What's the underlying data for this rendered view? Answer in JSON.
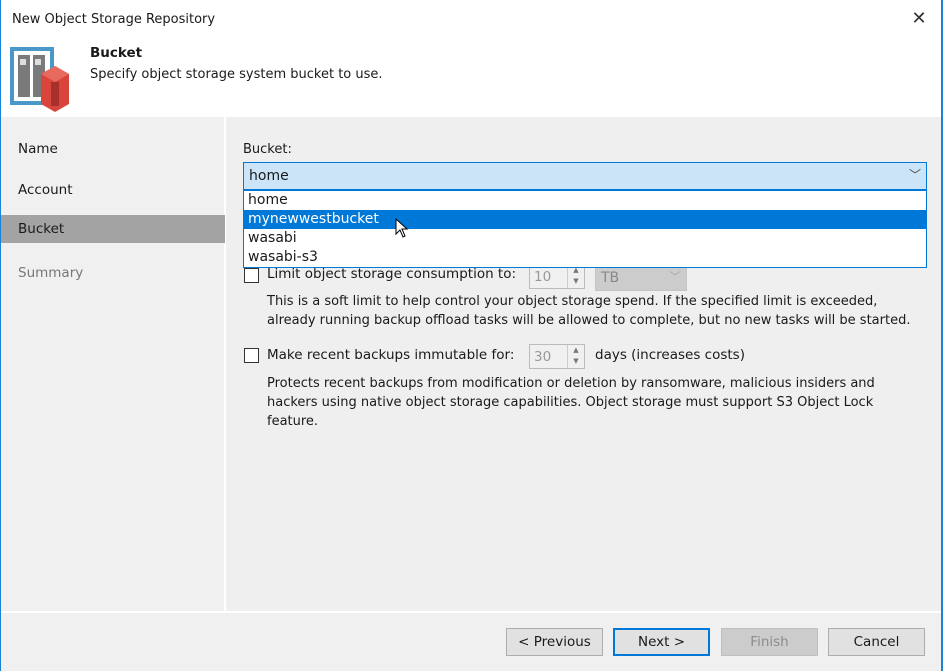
{
  "window": {
    "title": "New Object Storage Repository",
    "close_icon": "close-icon"
  },
  "header": {
    "title": "Bucket",
    "subtitle": "Specify object storage system bucket to use.",
    "icon": "object-storage-repository-icon"
  },
  "nav": {
    "items": [
      {
        "label": "Name",
        "state": "normal"
      },
      {
        "label": "Account",
        "state": "normal"
      },
      {
        "label": "Bucket",
        "state": "selected"
      },
      {
        "label": "Summary",
        "state": "disabled"
      }
    ]
  },
  "bucket": {
    "label": "Bucket:",
    "selected": "home",
    "options": [
      "home",
      "mynewwestbucket",
      "wasabi",
      "wasabi-s3"
    ],
    "highlighted": "mynewwestbucket"
  },
  "limit": {
    "label": "Limit object storage consumption to:",
    "checked": false,
    "value": "10",
    "unit": "TB",
    "desc1": "This is a soft limit to help control your object storage spend. If the specified limit is exceeded,",
    "desc2": "already running backup offload tasks will be allowed to complete, but no new tasks will be started."
  },
  "immutable": {
    "label": "Make recent backups immutable for:",
    "checked": false,
    "value": "30",
    "suffix": "days (increases costs)",
    "desc1": "Protects recent backups from modification or deletion by ransomware, malicious insiders and",
    "desc2": "hackers using native object storage capabilities. Object storage must support S3 Object Lock",
    "desc3": "feature."
  },
  "buttons": {
    "previous": "< Previous",
    "next": "Next >",
    "finish": "Finish",
    "cancel": "Cancel"
  },
  "colors": {
    "accent": "#0078d7",
    "selected_nav": "#a3a3a3",
    "combo_bg": "#cce4f7"
  }
}
